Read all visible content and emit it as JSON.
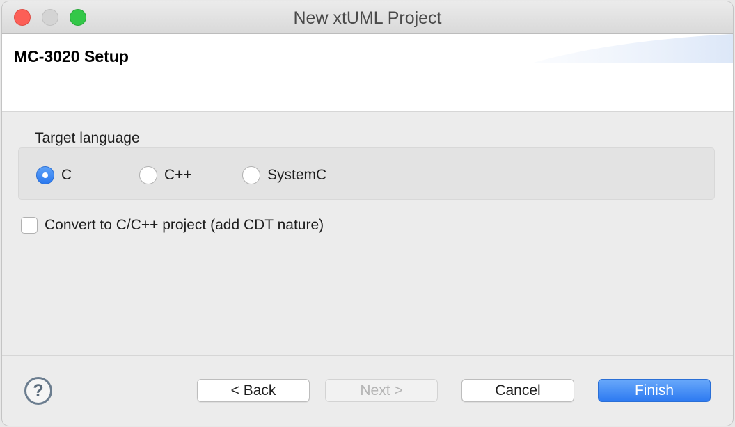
{
  "window": {
    "title": "New xtUML Project"
  },
  "header": {
    "title": "MC-3020 Setup"
  },
  "target_language": {
    "label": "Target language",
    "options": [
      {
        "label": "C",
        "selected": true
      },
      {
        "label": "C++",
        "selected": false
      },
      {
        "label": "SystemC",
        "selected": false
      }
    ]
  },
  "cdt_option": {
    "label": "Convert to C/C++ project (add CDT nature)",
    "checked": false
  },
  "footer": {
    "help_icon": "?",
    "back_label": "< Back",
    "next_label": "Next >",
    "cancel_label": "Cancel",
    "finish_label": "Finish"
  },
  "colors": {
    "accent": "#2d7af1",
    "close": "#fc5f57",
    "maximize": "#33c748"
  }
}
